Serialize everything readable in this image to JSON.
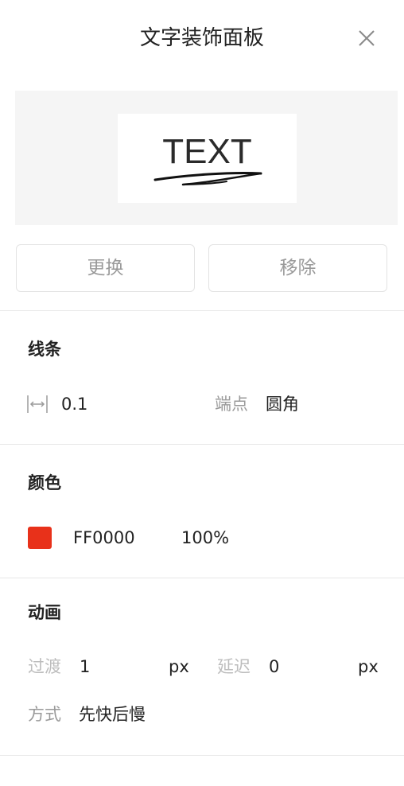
{
  "panel": {
    "title": "文字装饰面板"
  },
  "preview": {
    "text": "TEXT"
  },
  "actions": {
    "replace_label": "更换",
    "remove_label": "移除"
  },
  "line_section": {
    "title": "线条",
    "width_value": "0.1",
    "endpoint_label": "端点",
    "endpoint_value": "圆角"
  },
  "color_section": {
    "title": "颜色",
    "swatch_color": "#e8311a",
    "hex_value": "FF0000",
    "opacity_value": "100%"
  },
  "animation_section": {
    "title": "动画",
    "transition_label": "过渡",
    "transition_value": "1",
    "transition_unit": "px",
    "delay_label": "延迟",
    "delay_value": "0",
    "delay_unit": "px",
    "mode_label": "方式",
    "mode_value": "先快后慢"
  },
  "icons": {
    "close": "close-icon",
    "stroke_width": "stroke-width-icon"
  }
}
